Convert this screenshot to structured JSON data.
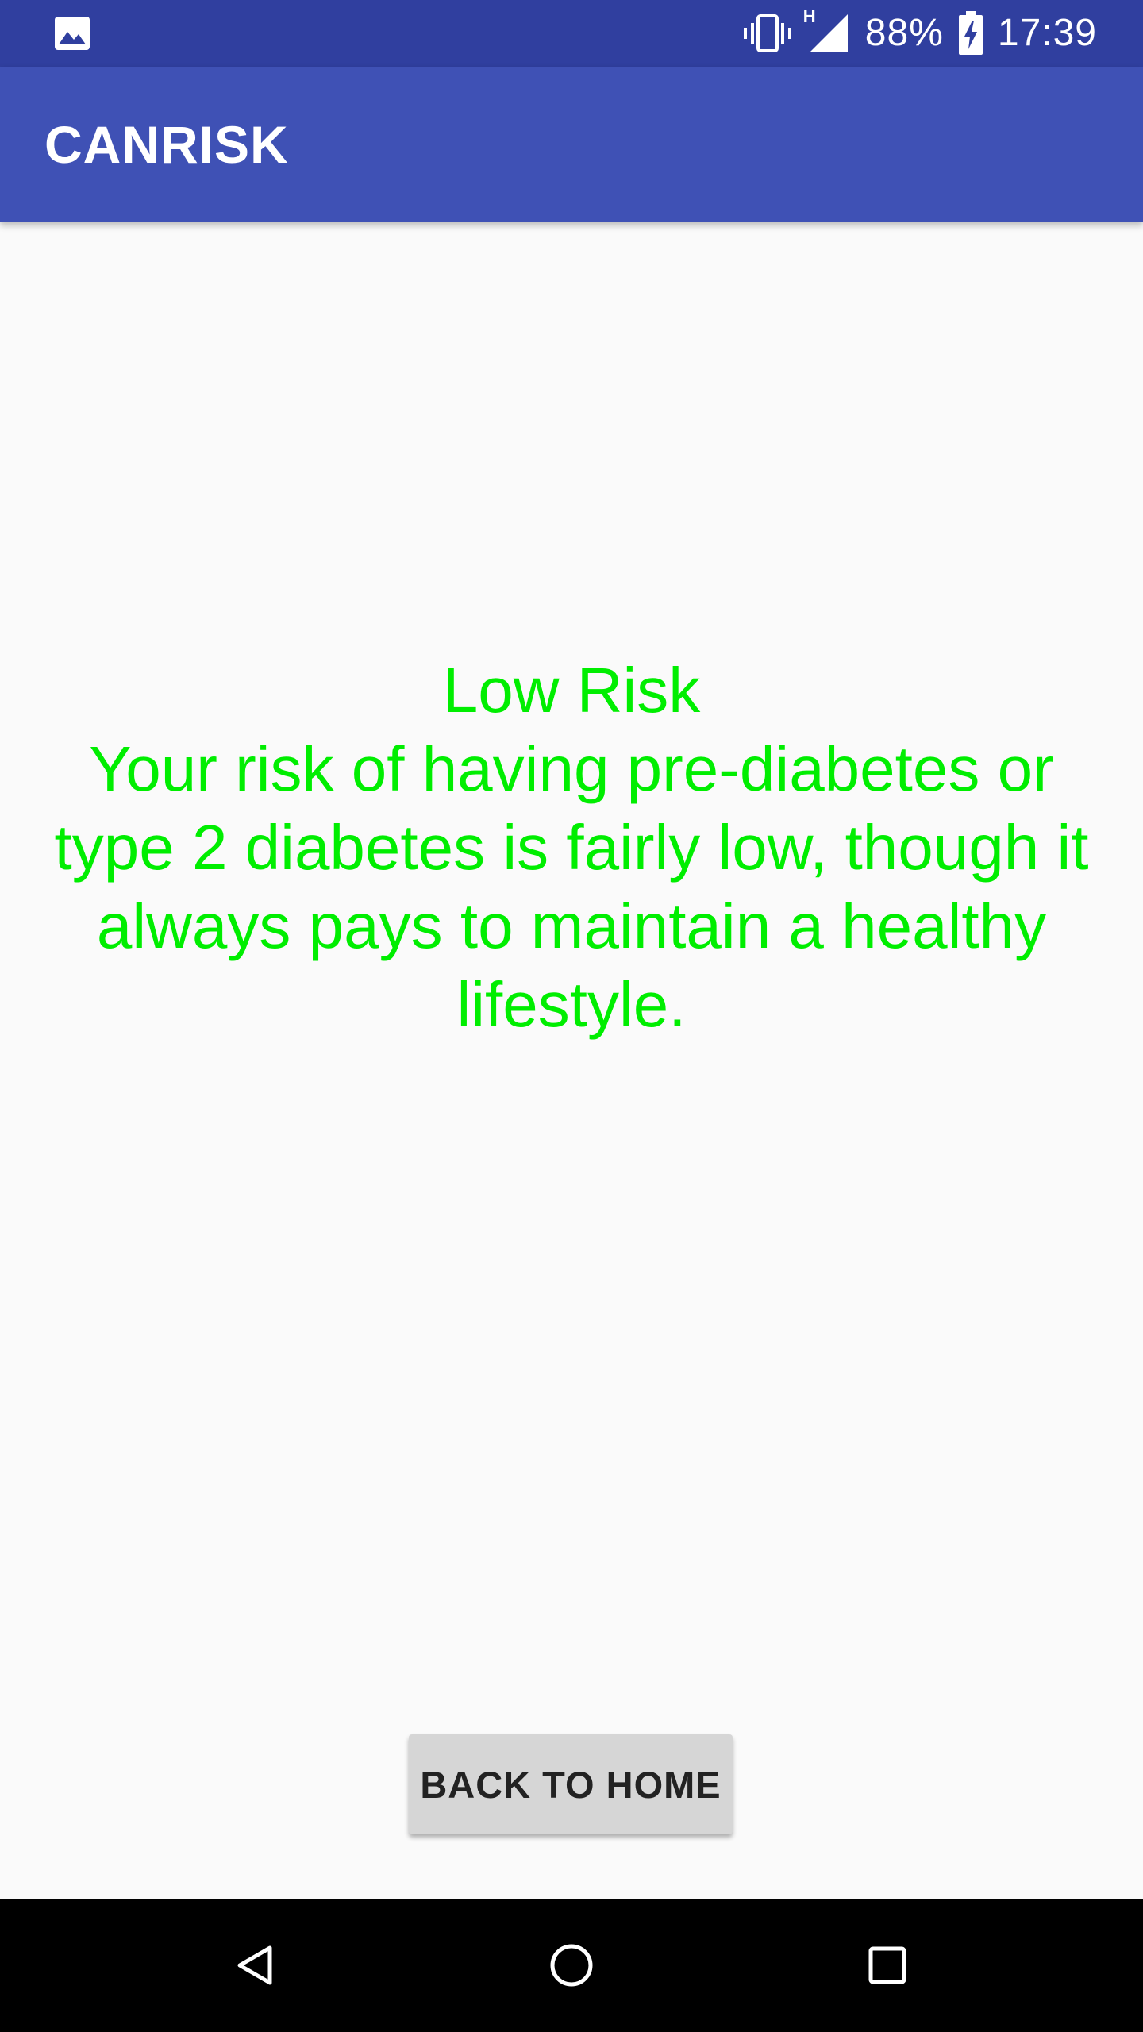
{
  "status_bar": {
    "notification_icon": "image-icon",
    "vibrate_icon": "vibrate-icon",
    "network_type": "H",
    "signal_icon": "signal-icon",
    "battery_percent": "88%",
    "battery_icon": "battery-charging-icon",
    "time": "17:39"
  },
  "app_bar": {
    "title": "CANRISK"
  },
  "result": {
    "risk_level": "Low Risk",
    "message": "Your risk of having pre-diabetes or type 2 diabetes is fairly low, though it always pays to maintain a healthy lifestyle.",
    "color": "#00ee00"
  },
  "actions": {
    "back_to_home_label": "BACK TO HOME"
  },
  "nav_bar": {
    "back_icon": "back-triangle-icon",
    "home_icon": "home-circle-icon",
    "recents_icon": "recents-square-icon"
  },
  "colors": {
    "status_bar": "#303f9f",
    "app_bar": "#3f51b5",
    "background": "#fafafa",
    "button": "#d6d6d6"
  }
}
